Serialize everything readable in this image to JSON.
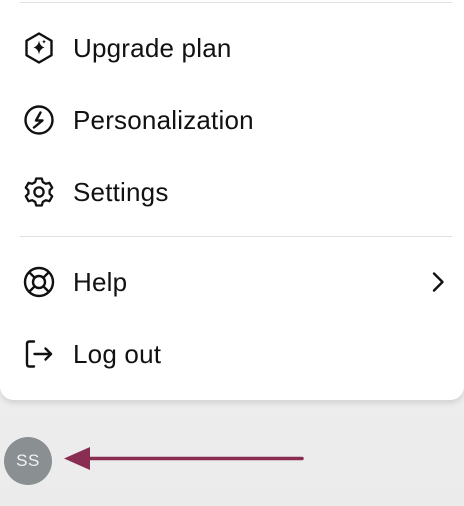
{
  "menu": {
    "items": [
      {
        "label": "Upgrade plan",
        "icon": "upgrade-sparkle-icon"
      },
      {
        "label": "Personalization",
        "icon": "personalization-icon"
      },
      {
        "label": "Settings",
        "icon": "gear-icon"
      },
      {
        "label": "Help",
        "icon": "lifebuoy-icon",
        "has_submenu": true
      },
      {
        "label": "Log out",
        "icon": "logout-icon"
      }
    ]
  },
  "user": {
    "initials": "SS"
  },
  "colors": {
    "menu_bg": "#ffffff",
    "text": "#111111",
    "avatar_bg": "#8a8f92",
    "annotation_arrow": "#8a2d52"
  },
  "annotation": {
    "type": "arrow",
    "points_to": "avatar"
  }
}
